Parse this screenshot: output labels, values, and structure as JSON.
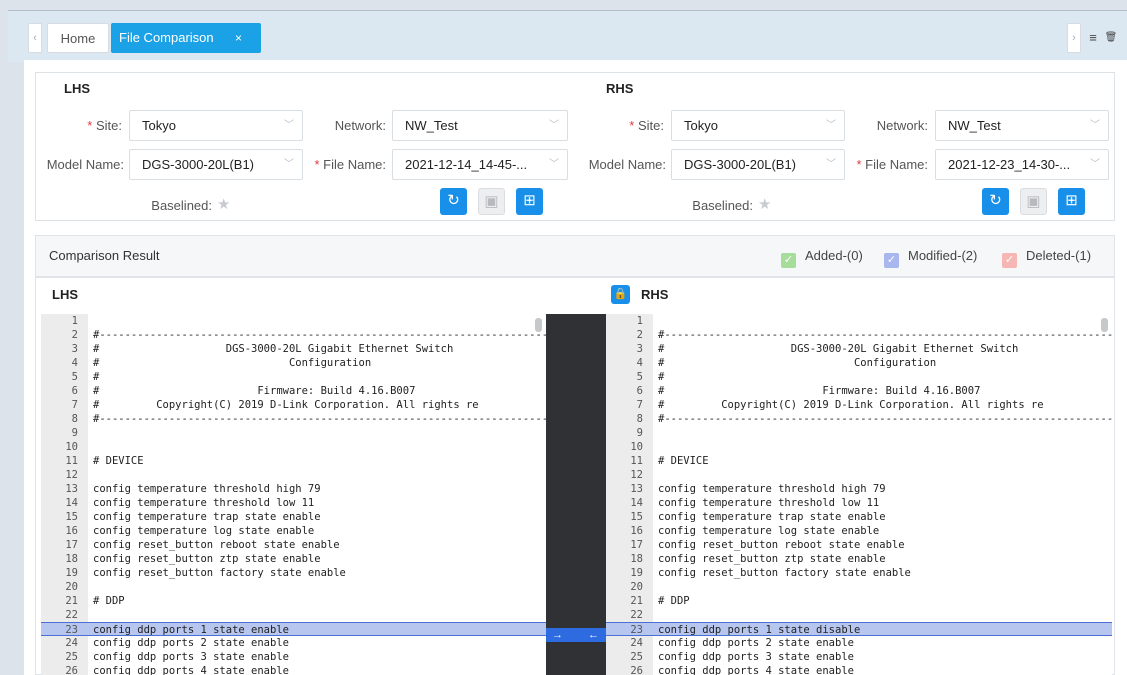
{
  "tabs": {
    "home": "Home",
    "active": "File Comparison",
    "close": "×",
    "prev": "‹",
    "next": "›",
    "menu": "≡",
    "trash": "🗑"
  },
  "lhs": {
    "title": "LHS",
    "site_label": "Site:",
    "site": "Tokyo",
    "network_label": "Network:",
    "network": "NW_Test",
    "model_label": "Model Name:",
    "model": "DGS-3000-20L(B1)",
    "file_label": "File Name:",
    "file": "2021-12-14_14-45-...",
    "baselined_label": "Baselined:"
  },
  "rhs": {
    "title": "RHS",
    "site_label": "Site:",
    "site": "Tokyo",
    "network_label": "Network:",
    "network": "NW_Test",
    "model_label": "Model Name:",
    "model": "DGS-3000-20L(B1)",
    "file_label": "File Name:",
    "file": "2021-12-23_14-30-...",
    "baselined_label": "Baselined:"
  },
  "required_mark": "*",
  "result": {
    "title": "Comparison Result",
    "added": "Added-(0)",
    "modified": "Modified-(2)",
    "deleted": "Deleted-(1)",
    "check": "✓"
  },
  "colors": {
    "added": "#a6dd9a",
    "modified": "#a8b8ee",
    "deleted": "#f6b6b3",
    "accent": "#1890e9"
  },
  "panes": {
    "left_title": "LHS",
    "right_title": "RHS",
    "arrow_right": "→",
    "arrow_left": "←"
  },
  "modified_line_index": 22,
  "left_lines": [
    "",
    "#-----------------------------------------------------------------------",
    "#                    DGS-3000-20L Gigabit Ethernet Switch",
    "#                              Configuration",
    "#",
    "#                         Firmware: Build 4.16.B007",
    "#         Copyright(C) 2019 D-Link Corporation. All rights re",
    "#-----------------------------------------------------------------------",
    "",
    "",
    "# DEVICE",
    "",
    "config temperature threshold high 79",
    "config temperature threshold low 11",
    "config temperature trap state enable",
    "config temperature log state enable",
    "config reset_button reboot state enable",
    "config reset_button ztp state enable",
    "config reset_button factory state enable",
    "",
    "# DDP",
    "",
    "config ddp ports 1 state enable",
    "config ddp ports 2 state enable",
    "config ddp ports 3 state enable",
    "config ddp ports 4 state enable"
  ],
  "right_lines": [
    "",
    "#-----------------------------------------------------------------------",
    "#                    DGS-3000-20L Gigabit Ethernet Switch",
    "#                              Configuration",
    "#",
    "#                         Firmware: Build 4.16.B007",
    "#         Copyright(C) 2019 D-Link Corporation. All rights re",
    "#-----------------------------------------------------------------------",
    "",
    "",
    "# DEVICE",
    "",
    "config temperature threshold high 79",
    "config temperature threshold low 11",
    "config temperature trap state enable",
    "config temperature log state enable",
    "config reset_button reboot state enable",
    "config reset_button ztp state enable",
    "config reset_button factory state enable",
    "",
    "# DDP",
    "",
    "config ddp ports 1 state disable",
    "config ddp ports 2 state enable",
    "config ddp ports 3 state enable",
    "config ddp ports 4 state enable"
  ]
}
